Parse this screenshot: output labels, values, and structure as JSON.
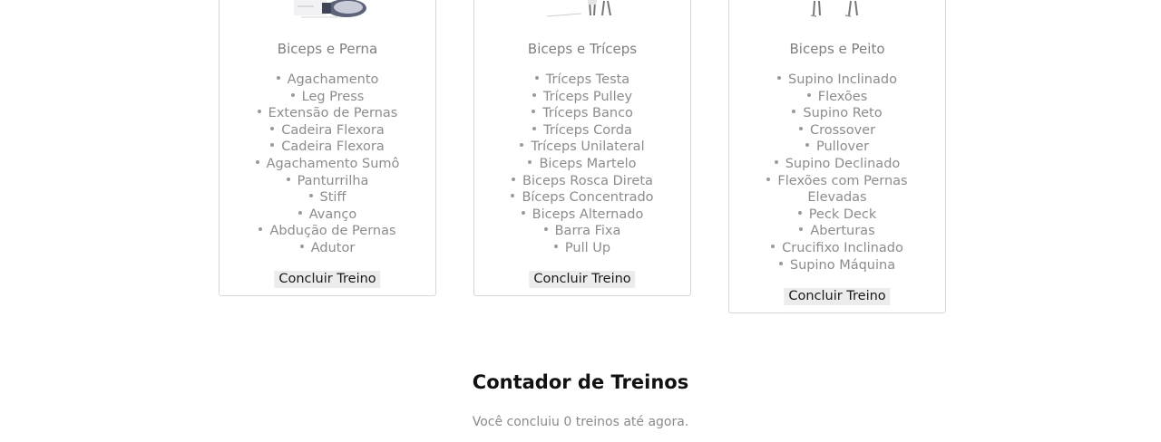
{
  "cards": [
    {
      "title": "Biceps e Perna",
      "image_icon": "leg-exercise-illustration",
      "exercises": [
        "Agachamento",
        "Leg Press",
        "Extensão de Pernas",
        "Cadeira Flexora",
        "Cadeira Flexora",
        "Agachamento Sumô",
        "Panturrilha",
        "Stiff",
        "Avanço",
        "Abdução de Pernas",
        "Adutor"
      ],
      "button_label": "Concluir Treino"
    },
    {
      "title": "Biceps e Tríceps",
      "image_icon": "arm-exercise-illustration",
      "exercises": [
        "Tríceps Testa",
        "Tríceps Pulley",
        "Tríceps Banco",
        "Tríceps Corda",
        "Tríceps Unilateral",
        "Biceps Martelo",
        "Biceps Rosca Direta",
        "Bíceps Concentrado",
        "Biceps Alternado",
        "Barra Fixa",
        "Pull Up"
      ],
      "button_label": "Concluir Treino"
    },
    {
      "title": "Biceps e Peito",
      "image_icon": "chest-exercise-illustration",
      "exercises": [
        "Supino Inclinado",
        "Flexões",
        "Supino Reto",
        "Crossover",
        "Pullover",
        "Supino Declinado",
        "Flexões com Pernas Elevadas",
        "Peck Deck",
        "Aberturas",
        "Crucifixo Inclinado",
        "Supino Máquina"
      ],
      "button_label": "Concluir Treino"
    }
  ],
  "counter": {
    "title": "Contador de Treinos",
    "text": "Você concluiu 0 treinos até agora."
  }
}
